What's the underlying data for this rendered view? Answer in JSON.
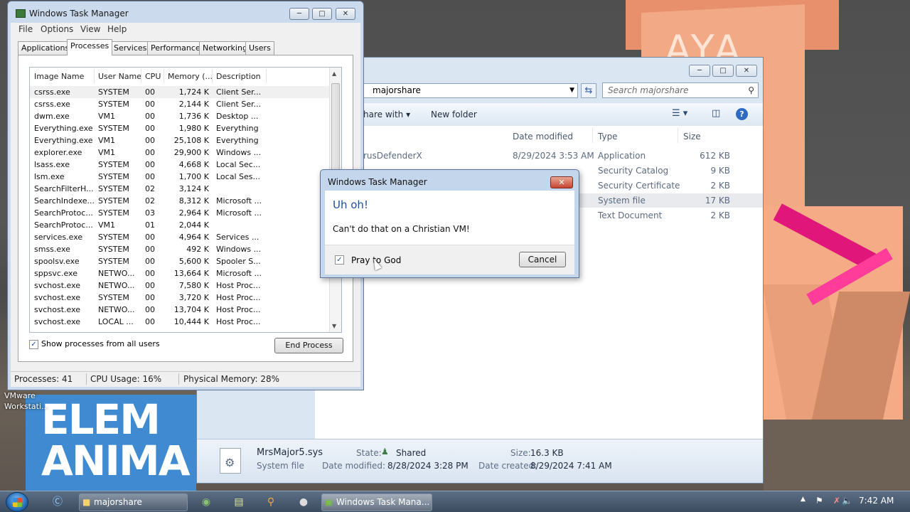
{
  "desktop": {
    "wallpaper_text": "AYA",
    "banner_line1": "ELEM",
    "banner_line2": "ANIMA",
    "vmware_label": "VMware Workstati..."
  },
  "explorer": {
    "address_path": "majorshare",
    "search_placeholder": "Search majorshare",
    "toolbar_share": "hare with",
    "toolbar_new_folder": "New folder",
    "columns": {
      "date_modified": "Date modified",
      "type": "Type",
      "size": "Size"
    },
    "rows": [
      {
        "name": "rusDefenderX",
        "date": "8/29/2024 3:53 AM",
        "type": "Application",
        "size": "612 KB"
      },
      {
        "name": "",
        "date": "",
        "type": "Security Catalog",
        "size": "9 KB"
      },
      {
        "name": "",
        "date": "",
        "type": "Security Certificate",
        "size": "2 KB"
      },
      {
        "name": "",
        "date": "",
        "type": "System file",
        "size": "17 KB"
      },
      {
        "name": "",
        "date": "",
        "type": "Text Document",
        "size": "2 KB"
      }
    ],
    "details": {
      "file_name": "MrsMajor5.sys",
      "file_type": "System file",
      "state_label": "State:",
      "state_value": "Shared",
      "modified_label": "Date modified:",
      "modified_value": "8/28/2024 3:28 PM",
      "size_label": "Size:",
      "size_value": "16.3 KB",
      "created_label": "Date created:",
      "created_value": "8/29/2024 7:41 AM"
    }
  },
  "task_manager": {
    "title": "Windows Task Manager",
    "menu": [
      "File",
      "Options",
      "View",
      "Help"
    ],
    "tabs": [
      "Applications",
      "Processes",
      "Services",
      "Performance",
      "Networking",
      "Users"
    ],
    "active_tab": "Processes",
    "columns": [
      "Image Name",
      "User Name",
      "CPU",
      "Memory (...",
      "Description"
    ],
    "processes": [
      {
        "image": "csrss.exe",
        "user": "SYSTEM",
        "cpu": "00",
        "mem": "1,724 K",
        "desc": "Client Ser..."
      },
      {
        "image": "csrss.exe",
        "user": "SYSTEM",
        "cpu": "00",
        "mem": "2,144 K",
        "desc": "Client Ser..."
      },
      {
        "image": "dwm.exe",
        "user": "VM1",
        "cpu": "00",
        "mem": "1,736 K",
        "desc": "Desktop ..."
      },
      {
        "image": "Everything.exe",
        "user": "SYSTEM",
        "cpu": "00",
        "mem": "1,980 K",
        "desc": "Everything"
      },
      {
        "image": "Everything.exe",
        "user": "VM1",
        "cpu": "00",
        "mem": "25,108 K",
        "desc": "Everything"
      },
      {
        "image": "explorer.exe",
        "user": "VM1",
        "cpu": "00",
        "mem": "29,900 K",
        "desc": "Windows ..."
      },
      {
        "image": "lsass.exe",
        "user": "SYSTEM",
        "cpu": "00",
        "mem": "4,668 K",
        "desc": "Local Sec..."
      },
      {
        "image": "lsm.exe",
        "user": "SYSTEM",
        "cpu": "00",
        "mem": "1,700 K",
        "desc": "Local Ses..."
      },
      {
        "image": "SearchFilterH...",
        "user": "SYSTEM",
        "cpu": "02",
        "mem": "3,124 K",
        "desc": ""
      },
      {
        "image": "SearchIndexe...",
        "user": "SYSTEM",
        "cpu": "02",
        "mem": "8,312 K",
        "desc": "Microsoft ..."
      },
      {
        "image": "SearchProtoc...",
        "user": "SYSTEM",
        "cpu": "03",
        "mem": "2,964 K",
        "desc": "Microsoft ..."
      },
      {
        "image": "SearchProtoc...",
        "user": "VM1",
        "cpu": "01",
        "mem": "2,044 K",
        "desc": ""
      },
      {
        "image": "services.exe",
        "user": "SYSTEM",
        "cpu": "00",
        "mem": "4,964 K",
        "desc": "Services ..."
      },
      {
        "image": "smss.exe",
        "user": "SYSTEM",
        "cpu": "00",
        "mem": "492 K",
        "desc": "Windows ..."
      },
      {
        "image": "spoolsv.exe",
        "user": "SYSTEM",
        "cpu": "00",
        "mem": "5,600 K",
        "desc": "Spooler S..."
      },
      {
        "image": "sppsvc.exe",
        "user": "NETWO...",
        "cpu": "00",
        "mem": "13,664 K",
        "desc": "Microsoft ..."
      },
      {
        "image": "svchost.exe",
        "user": "NETWO...",
        "cpu": "00",
        "mem": "7,580 K",
        "desc": "Host Proc..."
      },
      {
        "image": "svchost.exe",
        "user": "SYSTEM",
        "cpu": "00",
        "mem": "3,720 K",
        "desc": "Host Proc..."
      },
      {
        "image": "svchost.exe",
        "user": "NETWO...",
        "cpu": "00",
        "mem": "13,704 K",
        "desc": "Host Proc..."
      },
      {
        "image": "svchost.exe",
        "user": "LOCAL ...",
        "cpu": "00",
        "mem": "10,444 K",
        "desc": "Host Proc..."
      }
    ],
    "show_all_label": "Show processes from all users",
    "end_process_label": "End Process",
    "status": {
      "processes": "Processes: 41",
      "cpu": "CPU Usage: 16%",
      "memory": "Physical Memory: 28%"
    }
  },
  "dialog": {
    "title": "Windows Task Manager",
    "heading": "Uh oh!",
    "message": "Can't do that on a Christian VM!",
    "checkbox_label": "Pray to God",
    "cancel_label": "Cancel"
  },
  "taskbar": {
    "explorer_task": "majorshare",
    "taskmgr_task": "Windows Task Mana...",
    "clock": "7:42 AM"
  }
}
